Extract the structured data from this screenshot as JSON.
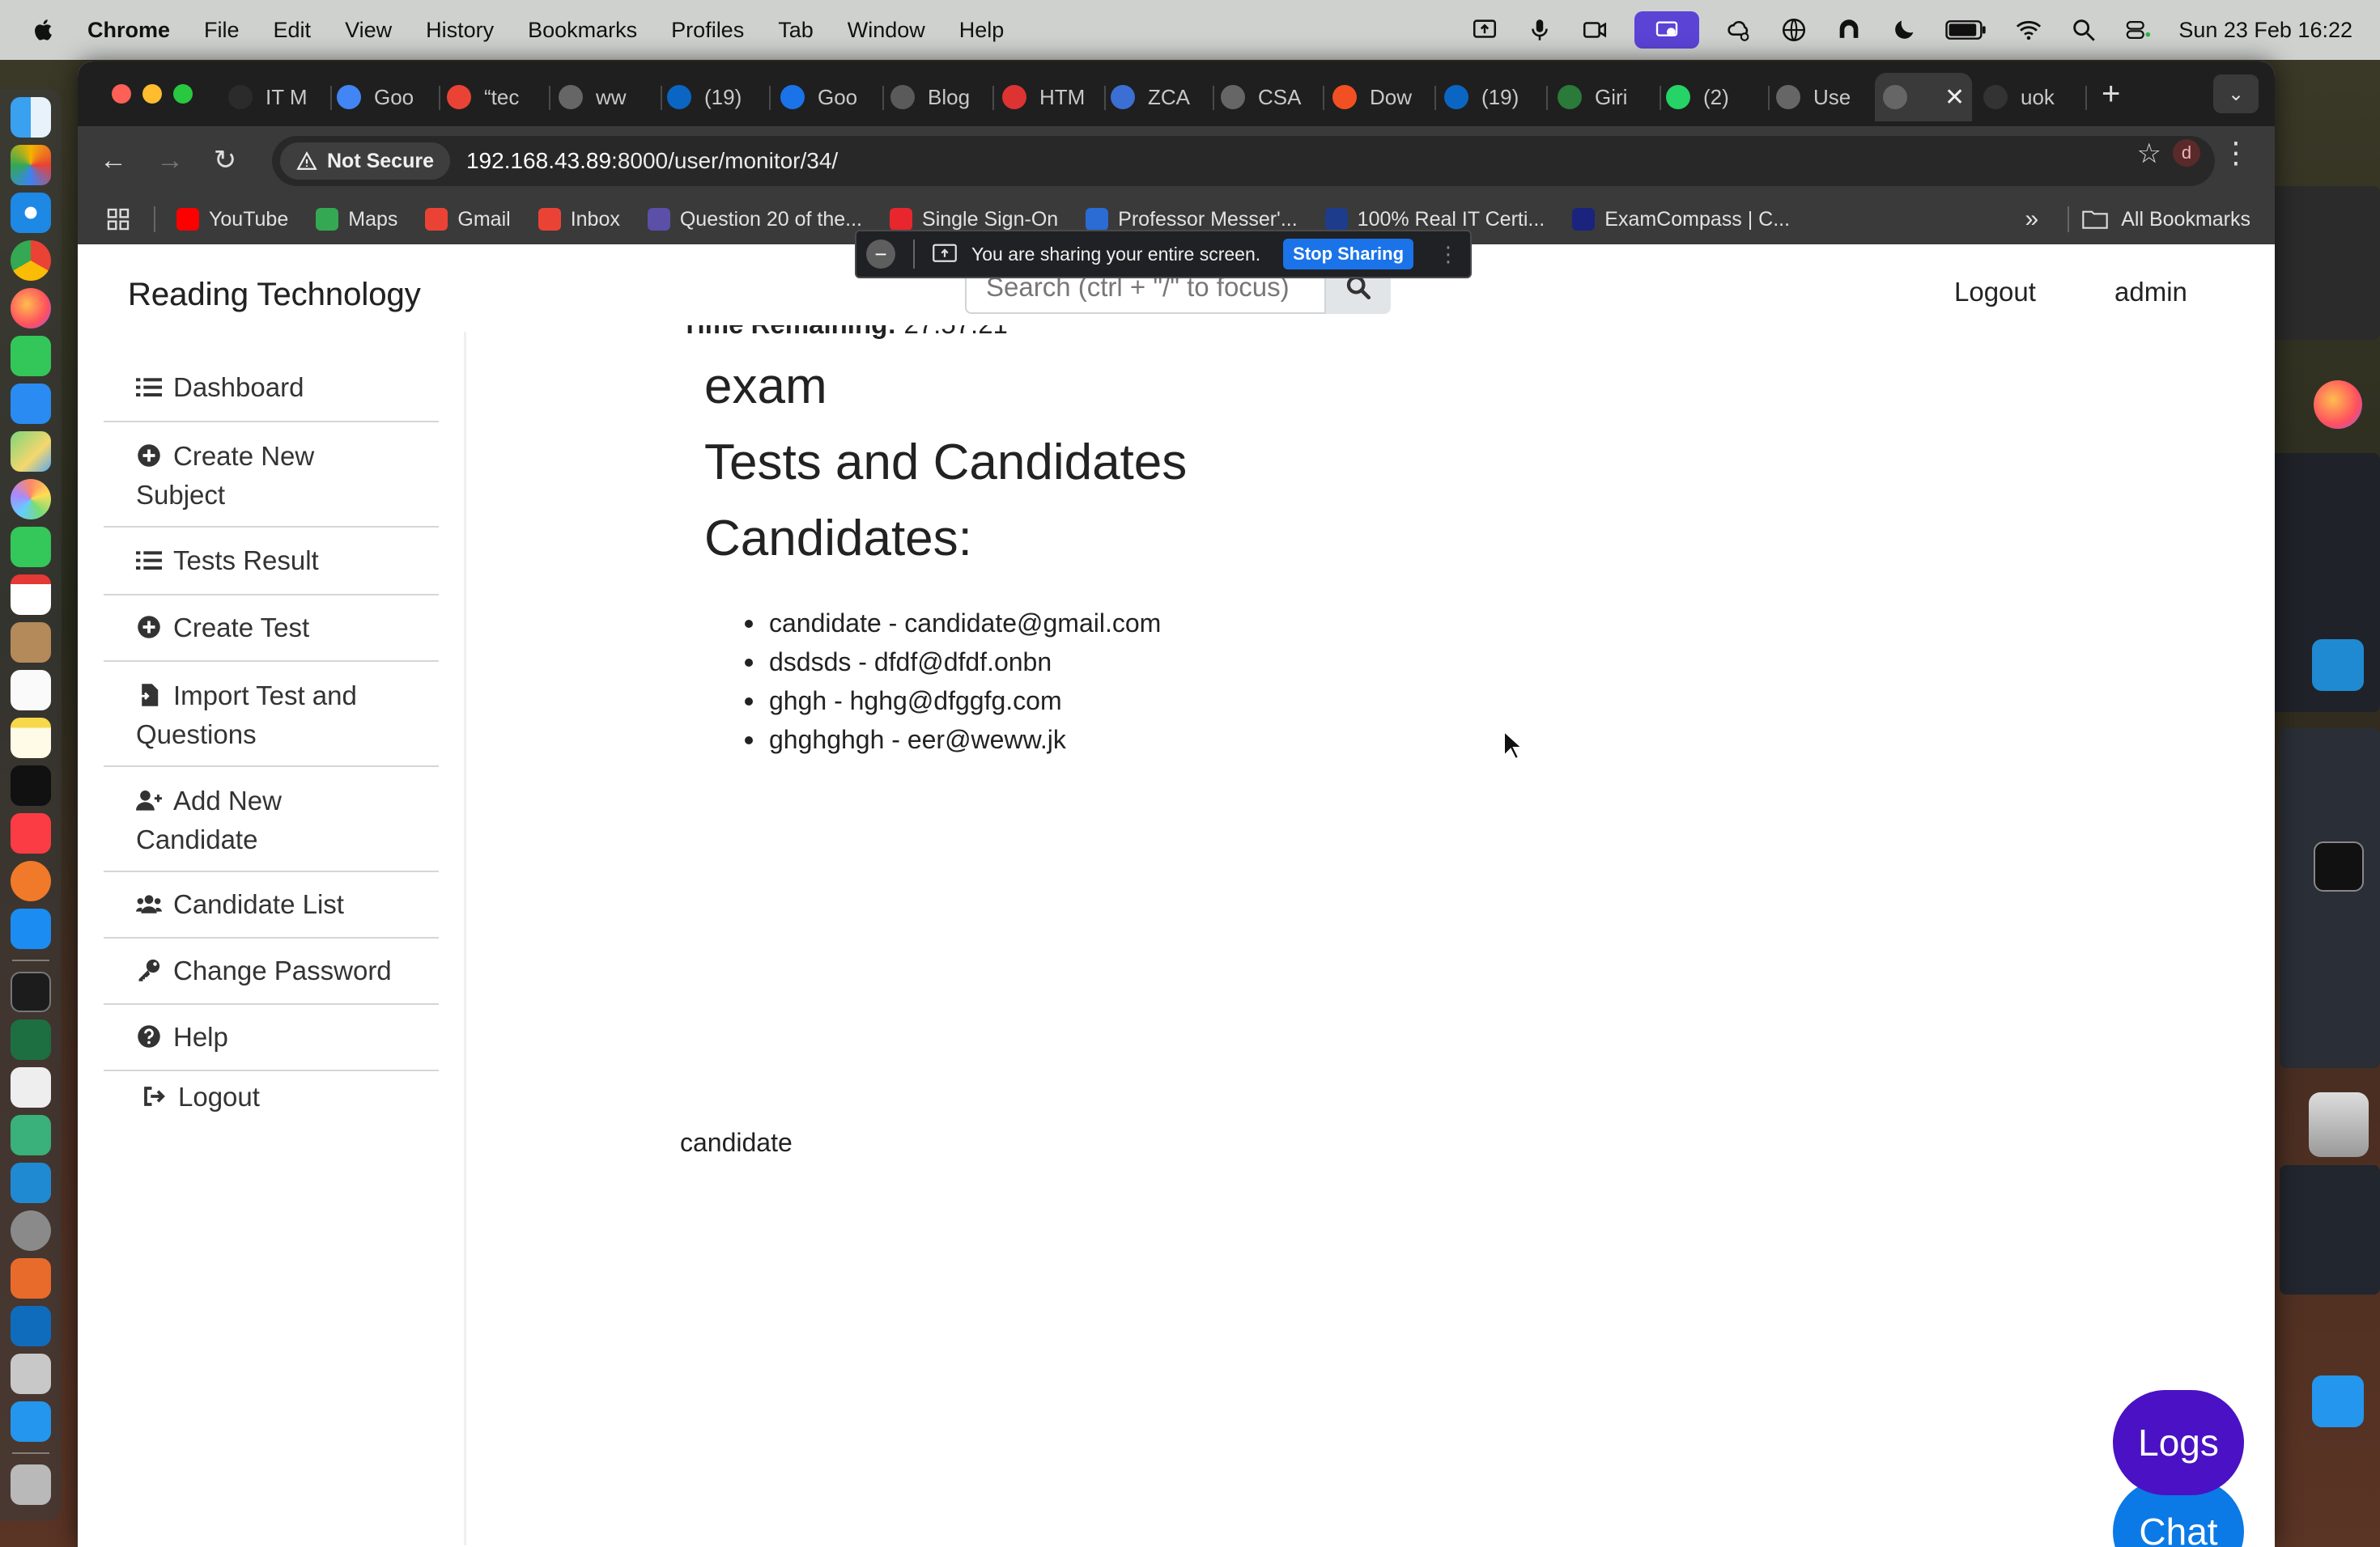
{
  "menubar": {
    "items": [
      "Chrome",
      "File",
      "Edit",
      "View",
      "History",
      "Bookmarks",
      "Profiles",
      "Tab",
      "Window",
      "Help"
    ],
    "clock": "Sun 23 Feb  16:22",
    "icons": [
      "screen-mirror-icon",
      "mic-icon",
      "camera-icon",
      "screen-record-icon",
      "weather-icon",
      "globe-icon",
      "vpn-icon",
      "moon-icon",
      "battery-icon",
      "wifi-icon",
      "spotlight-icon",
      "control-center-icon"
    ]
  },
  "tabs": [
    {
      "label": "IT M",
      "icon": "openai-icon",
      "color": "#2b2b2b"
    },
    {
      "label": "Goo",
      "icon": "google-icon",
      "color": "#4285f4"
    },
    {
      "label": "“tec",
      "icon": "gmail-icon",
      "color": "#ea4335"
    },
    {
      "label": "ww",
      "icon": "globe-icon",
      "color": "#666"
    },
    {
      "label": "(19)",
      "icon": "linkedin-icon",
      "color": "#0a66c2"
    },
    {
      "label": "Goo",
      "icon": "calendar-icon",
      "color": "#1a73e8"
    },
    {
      "label": "Blog",
      "icon": "wordpress-icon",
      "color": "#5a5a5a"
    },
    {
      "label": "HTM",
      "icon": "html-icon",
      "color": "#d33"
    },
    {
      "label": "ZCA",
      "icon": "zca-icon",
      "color": "#3b6fd4"
    },
    {
      "label": "CSA",
      "icon": "globe-icon",
      "color": "#666"
    },
    {
      "label": "Dow",
      "icon": "microsoft-icon",
      "color": "#f25022"
    },
    {
      "label": "(19)",
      "icon": "linkedin-icon",
      "color": "#0a66c2"
    },
    {
      "label": "Giri",
      "icon": "girl-icon",
      "color": "#2a7a3a"
    },
    {
      "label": "(2)",
      "icon": "whatsapp-icon",
      "color": "#25d366"
    },
    {
      "label": "Use",
      "icon": "globe-icon",
      "color": "#666"
    },
    {
      "label": "",
      "icon": "globe-icon",
      "color": "#666",
      "active": true
    },
    {
      "label": "uok",
      "icon": "github-icon",
      "color": "#333"
    }
  ],
  "toolbar": {
    "not_secure": "Not Secure",
    "url_host": "192.168.43.89",
    "url_path": ":8000/user/monitor/34/",
    "profile_initial": "d"
  },
  "bookmarks": [
    {
      "label": "YouTube",
      "color": "#ff0000"
    },
    {
      "label": "Maps",
      "color": "#34a853"
    },
    {
      "label": "Gmail",
      "color": "#ea4335"
    },
    {
      "label": "Inbox",
      "color": "#ea4335"
    },
    {
      "label": "Question 20 of the...",
      "color": "#5b4fa8"
    },
    {
      "label": "Single Sign-On",
      "color": "#e8262d"
    },
    {
      "label": "Professor Messer'...",
      "color": "#2a6bd4"
    },
    {
      "label": "100% Real IT Certi...",
      "color": "#1d3d8c"
    },
    {
      "label": "ExamCompass | C...",
      "color": "#1a237e"
    }
  ],
  "bookmarks_all": "All Bookmarks",
  "share": {
    "message": "You are sharing your entire screen.",
    "stop_label": "Stop Sharing"
  },
  "page": {
    "brand": "Reading Technology",
    "search_placeholder": "Search (ctrl + \"/\" to focus)",
    "logout": "Logout",
    "user": "admin",
    "time_label": "Time Remaining:",
    "time_value": "27:57:21",
    "exam_title": "exam",
    "tests_heading": "Tests and Candidates",
    "candidates_heading": "Candidates:",
    "candidates": [
      "candidate - candidate@gmail.com",
      "dsdsds - dfdf@dfdf.onbn",
      "ghgh - hghg@dfggfg.com",
      "ghghghgh - eer@weww.jk"
    ],
    "candidate_label": "candidate",
    "logs_button": "Logs",
    "chat_button": "Chat"
  },
  "sidebar": {
    "items": [
      {
        "label": "Dashboard",
        "icon": "list-icon"
      },
      {
        "label": "Create New Subject",
        "icon": "plus-circle-icon"
      },
      {
        "label": "Tests Result",
        "icon": "list-icon"
      },
      {
        "label": "Create Test",
        "icon": "plus-circle-icon"
      },
      {
        "label": "Import Test and Questions",
        "icon": "file-import-icon"
      },
      {
        "label": "Add New Candidate",
        "icon": "user-plus-icon"
      },
      {
        "label": "Candidate List",
        "icon": "users-icon"
      },
      {
        "label": "Change Password",
        "icon": "key-icon"
      },
      {
        "label": "Help",
        "icon": "question-circle-icon"
      },
      {
        "label": "Logout",
        "icon": "sign-out-icon"
      }
    ]
  },
  "colors": {
    "logs": "#4a12c4",
    "chat": "#0b7ae6",
    "stop_sharing": "#1a73e8"
  }
}
